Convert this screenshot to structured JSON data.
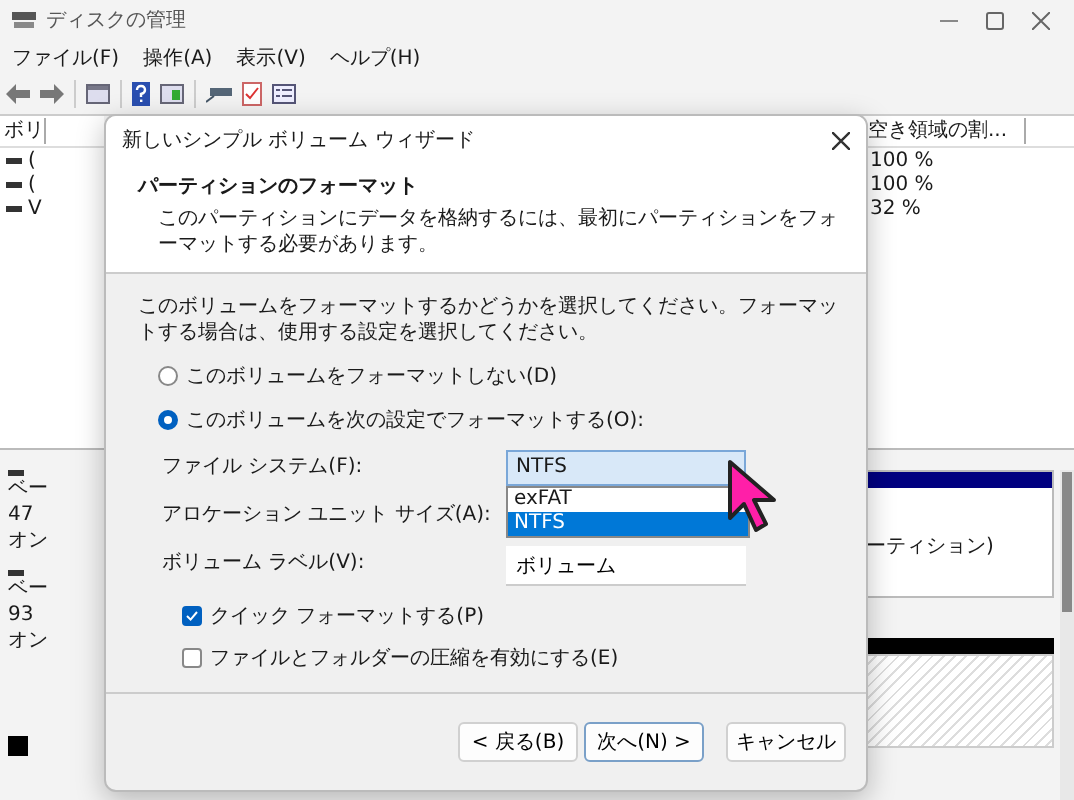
{
  "window": {
    "title": "ディスクの管理"
  },
  "menu": [
    "ファイル(F)",
    "操作(A)",
    "表示(V)",
    "ヘルプ(H)"
  ],
  "volume_table": {
    "column_1": "ボリ",
    "free_header": "空き領域の割...",
    "rows": [
      {
        "column_1": "(",
        "free": "100 %"
      },
      {
        "column_1": "(",
        "free": "100 %"
      },
      {
        "column_1": "V",
        "free": "32 %"
      }
    ]
  },
  "disks": [
    {
      "lines": [
        "ベー",
        "47",
        "オン"
      ]
    },
    {
      "lines": [
        "ベー",
        "93",
        "オン"
      ]
    }
  ],
  "disk_map": {
    "partition_text": "ーティション)"
  },
  "legend": [
    {
      "color": "#000000"
    }
  ],
  "dialog": {
    "title": "新しいシンプル ボリューム ウィザード",
    "heading": "パーティションのフォーマット",
    "subheading": "このパーティションにデータを格納するには、最初にパーティションをフォーマットする必要があります。",
    "instruction": "このボリュームをフォーマットするかどうかを選択してください。フォーマットする場合は、使用する設定を選択してください。",
    "options": [
      {
        "label": "このボリュームをフォーマットしない(D)",
        "selected": false
      },
      {
        "label": "このボリュームを次の設定でフォーマットする(O):",
        "selected": true
      }
    ],
    "fields": [
      {
        "kind": "dropdown",
        "label": "ファイル システム(F):",
        "value": "NTFS",
        "expanded": true,
        "options": [
          {
            "label": "exFAT",
            "selected": false
          },
          {
            "label": "NTFS",
            "selected": true
          }
        ]
      },
      {
        "kind": "label_only",
        "label": "アロケーション ユニット サイズ(A):"
      },
      {
        "kind": "text",
        "label": "ボリューム ラベル(V):",
        "value": "ボリューム"
      }
    ],
    "checkboxes": [
      {
        "label": "クイック フォーマットする(P)",
        "checked": true
      },
      {
        "label": "ファイルとフォルダーの圧縮を有効にする(E)",
        "checked": false
      }
    ],
    "buttons": [
      {
        "label": "< 戻る(B)",
        "default": false
      },
      {
        "label": "次へ(N) >",
        "default": true
      },
      {
        "label": "キャンセル",
        "default": false
      }
    ]
  }
}
